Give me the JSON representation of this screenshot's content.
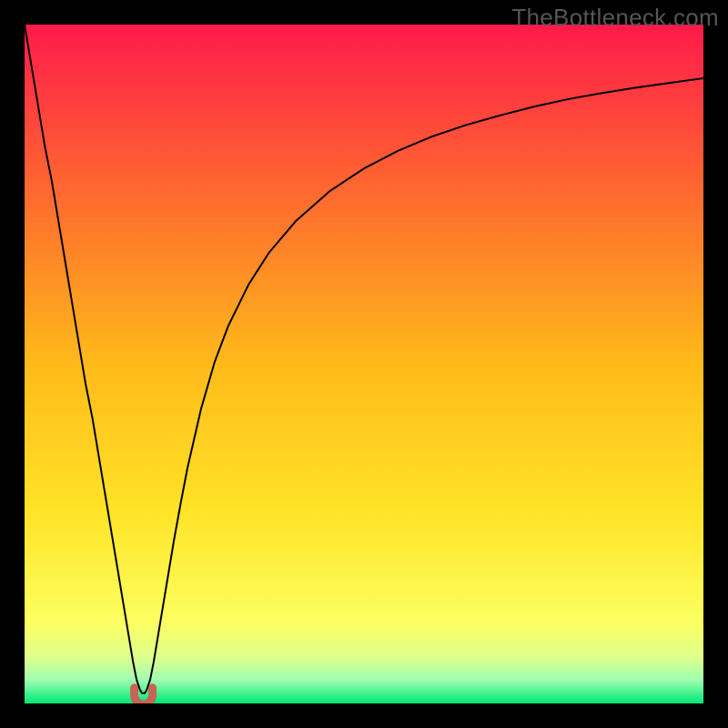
{
  "watermark": "TheBottleneck.com",
  "chart_data": {
    "type": "line",
    "title": "",
    "xlabel": "",
    "ylabel": "",
    "xlim": [
      0,
      100
    ],
    "ylim": [
      0,
      100
    ],
    "grid": false,
    "legend": false,
    "background_gradient": {
      "stops": [
        {
          "offset": 0.0,
          "color": "#ff1a4a"
        },
        {
          "offset": 0.25,
          "color": "#ff6a2f"
        },
        {
          "offset": 0.5,
          "color": "#ffba1a"
        },
        {
          "offset": 0.72,
          "color": "#ffe427"
        },
        {
          "offset": 0.88,
          "color": "#fcff60"
        },
        {
          "offset": 0.93,
          "color": "#e0ff8a"
        },
        {
          "offset": 0.965,
          "color": "#a0ffb0"
        },
        {
          "offset": 1.0,
          "color": "#00e676"
        }
      ]
    },
    "series": [
      {
        "name": "curve",
        "stroke": "#000000",
        "stroke_width": 2,
        "x": [
          0.0,
          1.0,
          2.0,
          3.0,
          4.0,
          5.0,
          6.0,
          7.0,
          8.0,
          9.0,
          10.0,
          11.0,
          12.0,
          13.0,
          14.0,
          15.0,
          15.5,
          16.0,
          16.5,
          17.0,
          17.3,
          17.7,
          18.0,
          18.5,
          19.0,
          19.5,
          20.0,
          21.0,
          22.0,
          23.0,
          24.0,
          26.0,
          28.0,
          30.0,
          33.0,
          36.0,
          40.0,
          45.0,
          50.0,
          55.0,
          60.0,
          65.0,
          70.0,
          75.0,
          80.0,
          85.0,
          90.0,
          95.0,
          100.0
        ],
        "y": [
          100.0,
          94.0,
          88.0,
          82.0,
          77.0,
          71.0,
          65.0,
          59.0,
          53.0,
          47.0,
          42.0,
          36.0,
          30.0,
          24.0,
          18.0,
          12.0,
          9.0,
          6.0,
          3.5,
          2.0,
          1.5,
          1.5,
          2.0,
          3.5,
          6.0,
          9.0,
          12.0,
          18.0,
          24.0,
          29.5,
          34.7,
          43.4,
          50.3,
          55.6,
          61.7,
          66.4,
          71.1,
          75.5,
          78.8,
          81.4,
          83.5,
          85.2,
          86.6,
          87.9,
          89.0,
          89.9,
          90.7,
          91.4,
          92.1
        ]
      },
      {
        "name": "bottom-marker",
        "type": "marker",
        "fill": "#c66455",
        "stroke": "#c66455",
        "shape": "u",
        "x": 17.5,
        "y": 1.5,
        "radius_px": 10
      }
    ]
  }
}
